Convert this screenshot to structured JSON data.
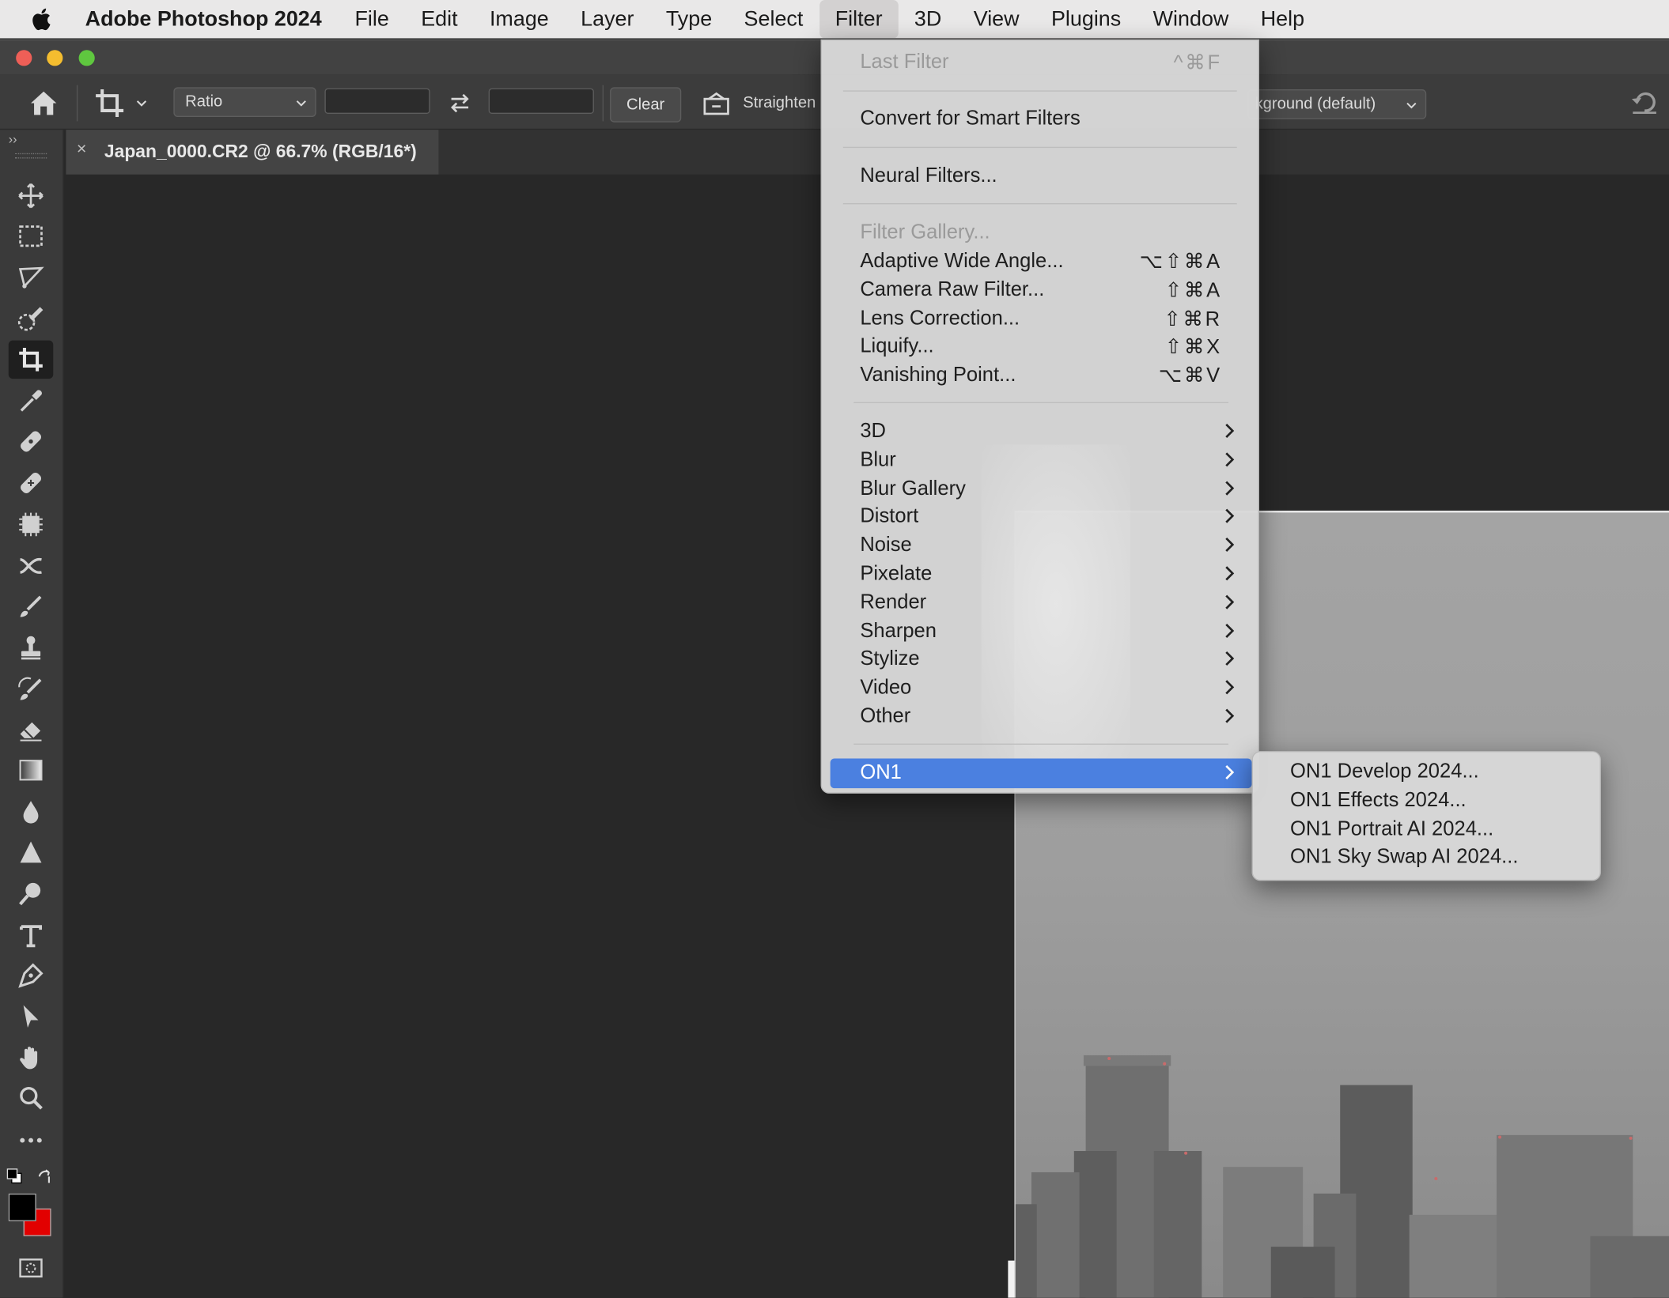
{
  "menubar": {
    "app_name": "Adobe Photoshop 2024",
    "items": [
      "File",
      "Edit",
      "Image",
      "Layer",
      "Type",
      "Select",
      "Filter",
      "3D",
      "View",
      "Plugins",
      "Window",
      "Help"
    ],
    "active": "Filter"
  },
  "options_bar": {
    "ratio_select": "Ratio",
    "width_value": "",
    "height_value": "",
    "clear_label": "Clear",
    "straighten_label": "Straighten",
    "background_select": "kground (default)"
  },
  "document_tab": {
    "title": "Japan_0000.CR2 @ 66.7% (RGB/16*)",
    "close_glyph": "×"
  },
  "toolbar": {
    "collapse_glyph": "››",
    "tools": [
      "move-tool-icon",
      "rectangular-marquee-icon",
      "lasso-icon",
      "quick-selection-icon",
      "crop-icon",
      "eyedropper-icon",
      "spot-healing-icon",
      "healing-brush-icon",
      "content-aware-move-icon",
      "red-eye-icon",
      "brush-icon",
      "clone-stamp-icon",
      "history-brush-icon",
      "eraser-icon",
      "gradient-icon",
      "blur-icon",
      "sharpen-icon",
      "dodge-icon",
      "type-icon",
      "pen-icon",
      "path-selection-icon",
      "hand-icon",
      "zoom-icon",
      "more-tools-icon"
    ],
    "selected_tool": "crop-icon",
    "foreground_color": "#000000",
    "background_color": "#e20000"
  },
  "filter_menu": {
    "last_filter": {
      "label": "Last Filter",
      "shortcut": "^⌘F"
    },
    "convert_smart": "Convert for Smart Filters",
    "neural_filters": "Neural Filters...",
    "filter_gallery": "Filter Gallery...",
    "filters": [
      {
        "label": "Adaptive Wide Angle...",
        "shortcut": "⌥⇧⌘A"
      },
      {
        "label": "Camera Raw Filter...",
        "shortcut": "⇧⌘A"
      },
      {
        "label": "Lens Correction...",
        "shortcut": "⇧⌘R"
      },
      {
        "label": "Liquify...",
        "shortcut": "⇧⌘X"
      },
      {
        "label": "Vanishing Point...",
        "shortcut": "⌥⌘V"
      }
    ],
    "submenus": [
      "3D",
      "Blur",
      "Blur Gallery",
      "Distort",
      "Noise",
      "Pixelate",
      "Render",
      "Sharpen",
      "Stylize",
      "Video",
      "Other"
    ],
    "on1": "ON1"
  },
  "on1_submenu": {
    "items": [
      "ON1 Develop 2024...",
      "ON1 Effects 2024...",
      "ON1 Portrait AI 2024...",
      "ON1 Sky Swap AI 2024..."
    ]
  }
}
